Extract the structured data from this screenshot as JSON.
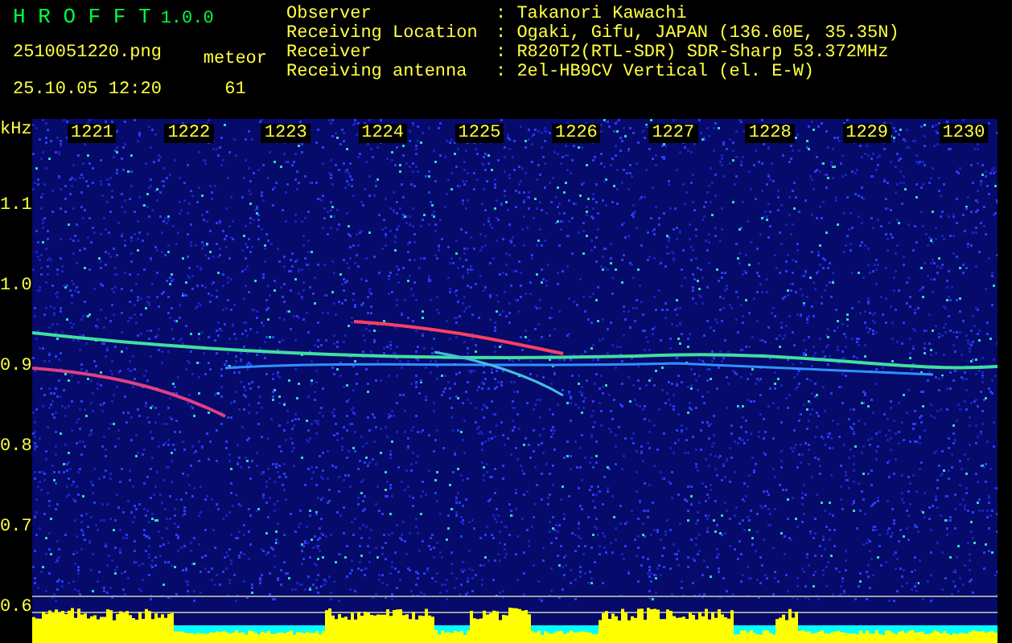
{
  "app": {
    "name": "H R O F F T",
    "version": "1.0.0"
  },
  "file": {
    "filename": "2510051220.png",
    "datetime": "25.10.05 12:20",
    "counter_label": "meteor",
    "counter_value": "61"
  },
  "info": [
    {
      "label": "Observer",
      "value": ": Takanori Kawachi"
    },
    {
      "label": "Receiving Location",
      "value": ": Ogaki, Gifu, JAPAN (136.60E, 35.35N)"
    },
    {
      "label": "Receiver",
      "value": ": R820T2(RTL-SDR) SDR-Sharp 53.372MHz"
    },
    {
      "label": "Receiving antenna",
      "value": ": 2el-HB9CV Vertical (el. E-W)"
    }
  ],
  "spectrogram": {
    "unit": "kHz",
    "time_ticks": [
      "1221",
      "1222",
      "1223",
      "1224",
      "1225",
      "1226",
      "1227",
      "1228",
      "1229",
      "1230"
    ],
    "freq_ticks": [
      "1.1",
      "1.0",
      "0.9",
      "0.8",
      "0.7",
      "0.6"
    ]
  }
}
